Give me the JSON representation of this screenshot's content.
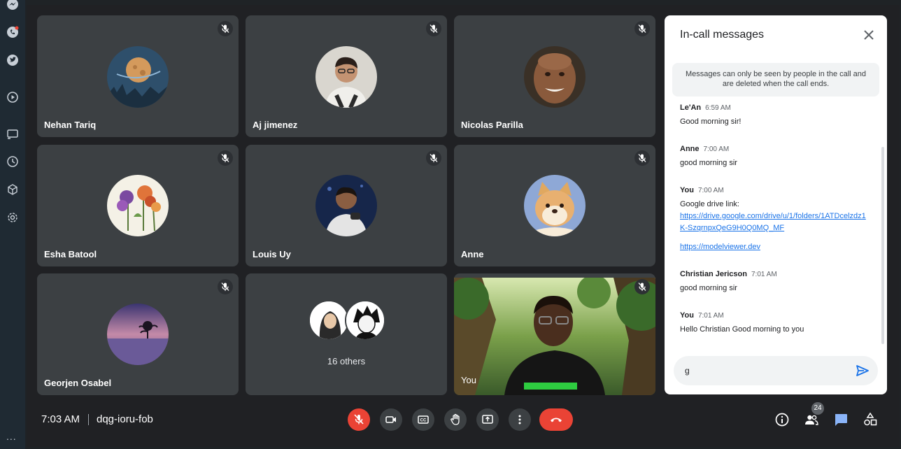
{
  "rail": {
    "icons": [
      "messenger-icon",
      "whatsapp-icon",
      "twitter-icon",
      "play-icon",
      "cast-icon",
      "history-icon",
      "box-icon",
      "settings-icon"
    ],
    "more": "..."
  },
  "tiles": [
    {
      "name": "Nehan Tariq",
      "avatar": "moon-avatar"
    },
    {
      "name": "Aj jimenez",
      "avatar": "person-avatar"
    },
    {
      "name": "Nicolas Parilla",
      "avatar": "person-avatar"
    },
    {
      "name": "Esha Batool",
      "avatar": "flowers-avatar"
    },
    {
      "name": "Louis Uy",
      "avatar": "person-avatar"
    },
    {
      "name": "Anne",
      "avatar": "cartoon-dog-avatar"
    },
    {
      "name": "Georjen Osabel",
      "avatar": "sunset-tree-avatar"
    }
  ],
  "others": {
    "label": "16 others"
  },
  "self": {
    "label": "You"
  },
  "chat": {
    "title": "In-call messages",
    "notice": "Messages can only be seen by people in the call and are deleted when the call ends.",
    "messages": [
      {
        "sender": "Le'An",
        "time": "6:59 AM",
        "text": "Good morning sir!"
      },
      {
        "sender": "Anne",
        "time": "7:00 AM",
        "text": "good morning sir"
      },
      {
        "sender": "You",
        "time": "7:00 AM",
        "text": "Google drive link:",
        "links": [
          "https://drive.google.com/drive/u/1/folders/1ATDcelzdz1K-SzqrnpxQeG9H0Q0MQ_MF",
          "https://modelviewer.dev"
        ]
      },
      {
        "sender": "Christian Jericson",
        "time": "7:01 AM",
        "text": "good morning sir"
      },
      {
        "sender": "You",
        "time": "7:01 AM",
        "text": "Hello Christian Good morning to you"
      }
    ],
    "compose_value": "g"
  },
  "bottom": {
    "time": "7:03 AM",
    "meeting_code": "dqg-ioru-fob",
    "participants_count": "24"
  },
  "colors": {
    "background": "#202124",
    "tile": "#3c4043",
    "red": "#ea4335",
    "accent": "#1a73e8",
    "chat_active": "#8ab4f8"
  }
}
